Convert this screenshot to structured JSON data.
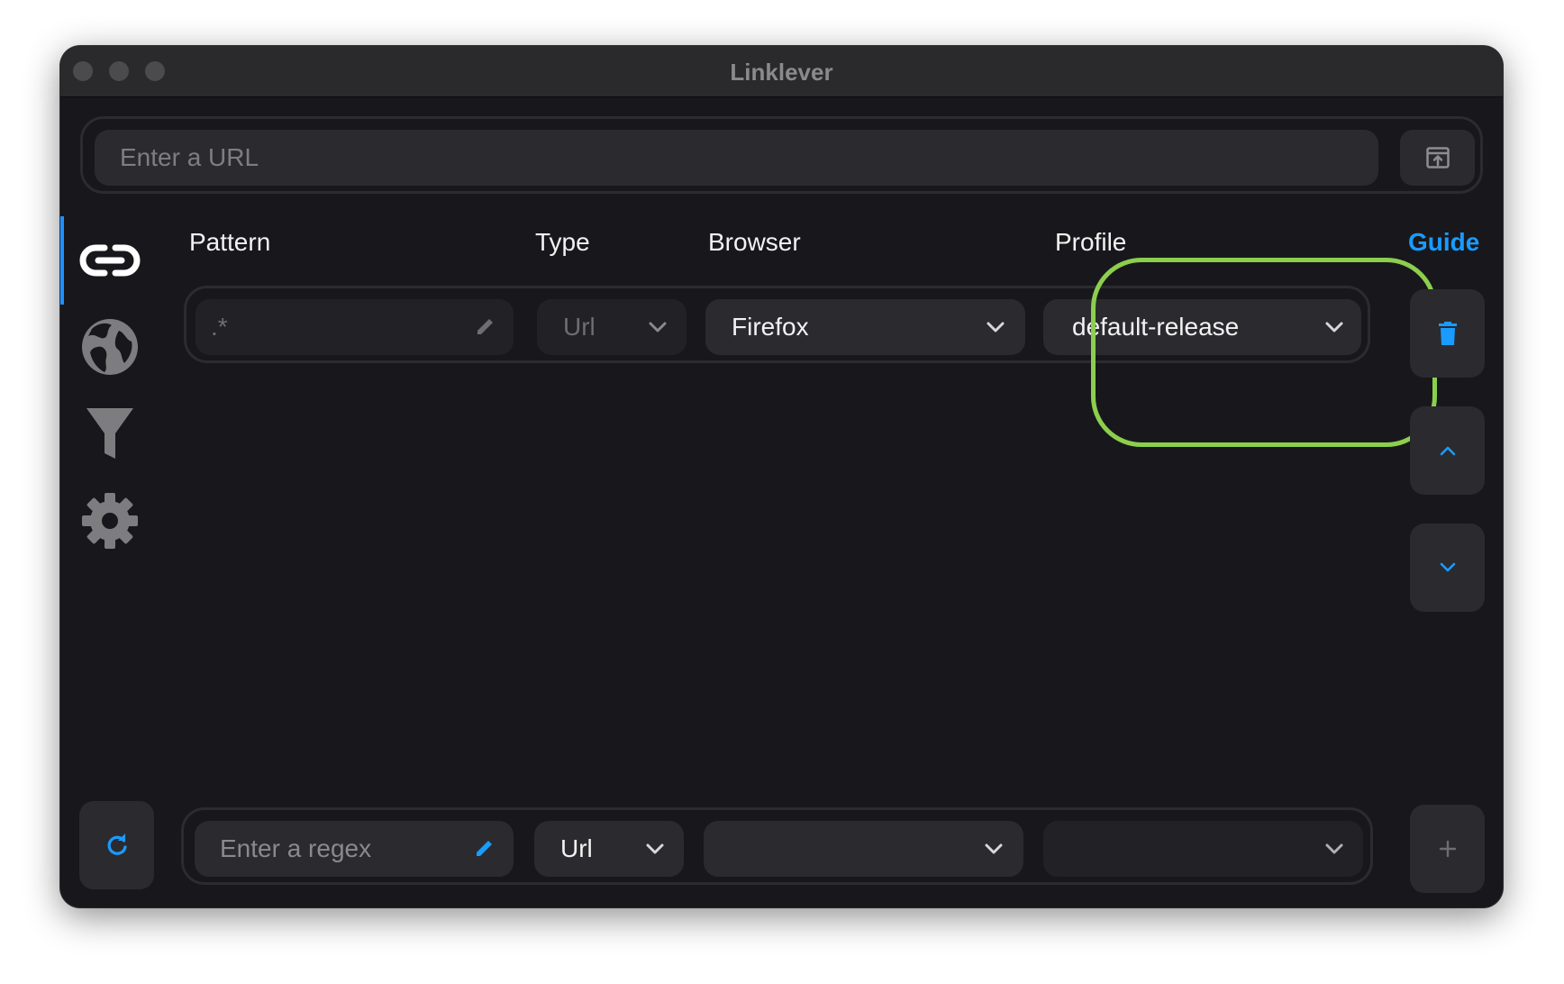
{
  "window": {
    "title": "Linklever"
  },
  "url_bar": {
    "placeholder": "Enter a URL",
    "open_icon": "open-in-browser-icon"
  },
  "sidebar": {
    "items": [
      {
        "name": "rules",
        "icon": "link-icon",
        "active": true
      },
      {
        "name": "browsers",
        "icon": "globe-icon",
        "active": false
      },
      {
        "name": "filters",
        "icon": "funnel-icon",
        "active": false
      },
      {
        "name": "settings",
        "icon": "gear-icon",
        "active": false
      }
    ]
  },
  "columns": {
    "pattern": "Pattern",
    "type": "Type",
    "browser": "Browser",
    "profile": "Profile",
    "guide": "Guide"
  },
  "rules": [
    {
      "pattern": ".*",
      "type": "Url",
      "browser": "Firefox",
      "profile": "default-release"
    }
  ],
  "new_rule": {
    "pattern_placeholder": "Enter a regex",
    "type": "Url",
    "browser": "",
    "profile": ""
  },
  "actions": {
    "delete_icon": "trash-icon",
    "move_up_icon": "chevron-up-icon",
    "move_down_icon": "chevron-down-icon",
    "add_icon": "plus-icon",
    "refresh_icon": "refresh-icon"
  },
  "colors": {
    "accent": "#1a9bff",
    "background": "#18181c",
    "field": "#2b2b2f",
    "highlight": "#8ccf4d"
  }
}
